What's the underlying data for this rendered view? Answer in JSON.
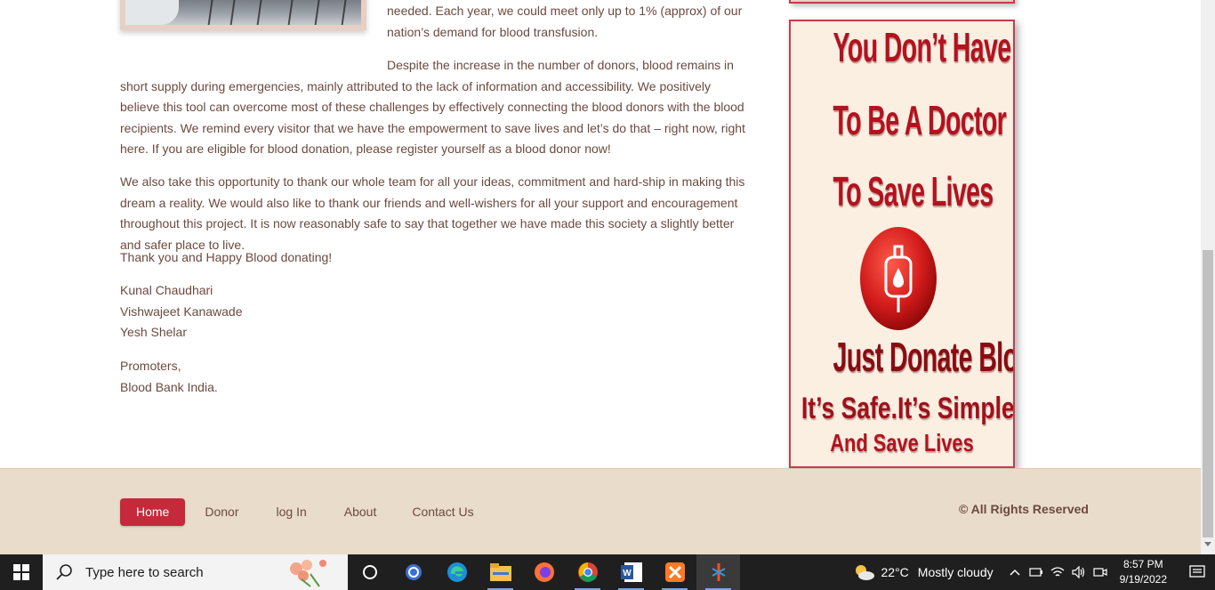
{
  "article": {
    "p1_line1": "needed. Each year, we could meet only up to 1% (approx) of our",
    "p1_line2": "nation’s demand for blood transfusion.",
    "p2": "Despite the increase in the number of donors, blood remains in short supply during emergencies, mainly attributed to the lack of information and accessibility. We positively believe this tool can overcome most of these challenges by effectively connecting the blood donors with the blood recipients. We remind every visitor that we have the empowerment to save lives and let’s do that – right now, right here. If you are eligible for blood donation, please register yourself as a blood donor now!",
    "p3": "We also take this opportunity to thank our whole team for all your ideas, commitment and hard-ship in making this dream a reality. We would also like to thank our friends and well-wishers for all your support and encouragement throughout this project. It is now reasonably safe to say that together we have made this society a slightly better and safer place to live.",
    "p4": "Thank you and Happy Blood donating!",
    "signatures": [
      "Kunal Chaudhari",
      "Vishwajeet Kanawade",
      "Yesh Shelar"
    ],
    "closing": [
      "Promoters,",
      "Blood Bank India."
    ]
  },
  "poster": {
    "line1": "You Don’t Have",
    "line2": "To Be A Doctor",
    "line3": "To Save Lives",
    "line4": "Just Donate Blood",
    "line5": "It’s Safe.It’s Simple",
    "line6": "And Save Lives",
    "icon": "blood-bag-icon"
  },
  "footer": {
    "nav": [
      "Home",
      "Donor",
      "log In",
      "About",
      "Contact Us"
    ],
    "active": "Home",
    "copyright": "© All Rights Reserved"
  },
  "taskbar": {
    "search_placeholder": "Type here to search",
    "apps": [
      "cortana-icon",
      "activity-icon",
      "edge-icon",
      "file-explorer-icon",
      "firefox-icon",
      "chrome-icon",
      "word-icon",
      "xampp-icon",
      "snipping-icon"
    ],
    "weather_temp": "22°C",
    "weather_cond": "Mostly cloudy",
    "time": "8:57 PM",
    "date": "9/19/2022"
  },
  "colors": {
    "accent": "#c62a3a",
    "text": "#6b4a3f",
    "footer_bg": "#eadccb",
    "poster_bg": "#fbefe2"
  }
}
